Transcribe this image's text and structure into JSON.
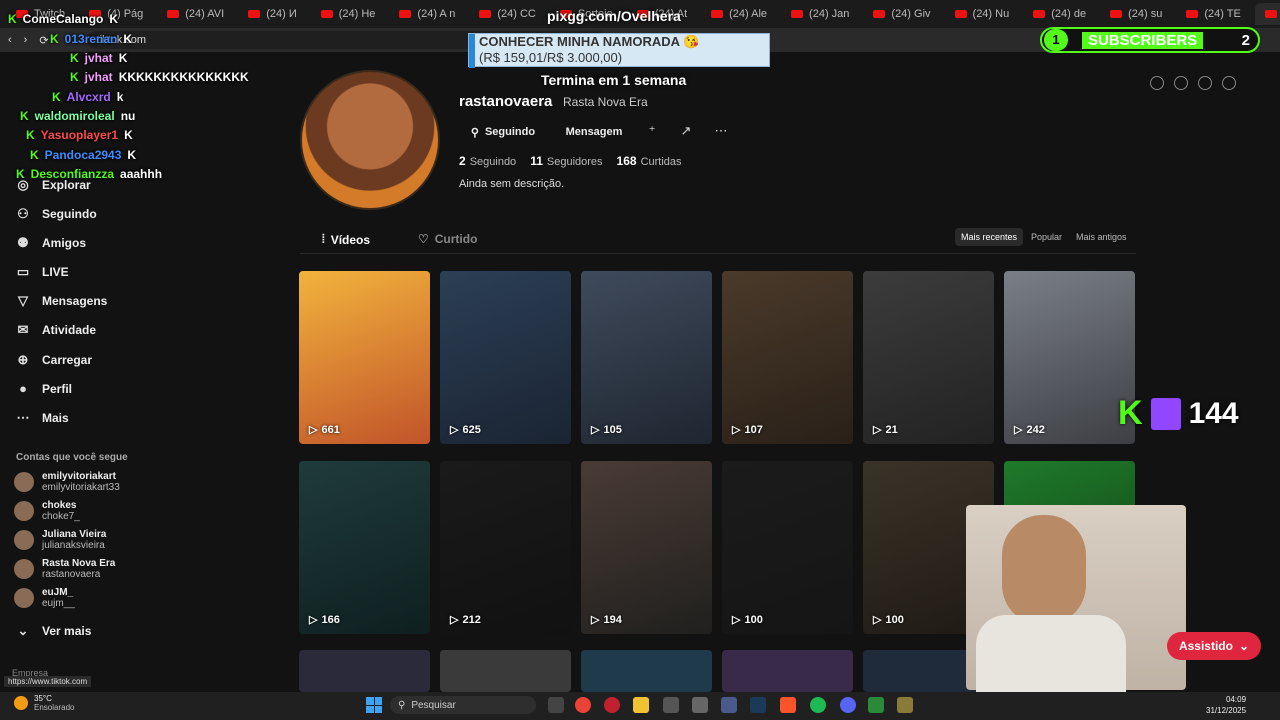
{
  "browser": {
    "tabs": [
      "Twitch",
      "(4) Pág",
      "(24) AVI",
      "(24) И",
      "(24) He",
      "(24) A n",
      "(24) CC",
      "Sorteio",
      "(24) At",
      "(24) Ale",
      "(24) Jan",
      "(24) Giv",
      "(24) Nu",
      "(24) de",
      "(24) su",
      "(24) TE",
      "(4)"
    ],
    "url": "tiktok.com"
  },
  "overlay": {
    "pixgg": "pixgg.com/Ovelhera",
    "banner_line1": "CONHECER MINHA NAMORADA 😘",
    "banner_line2": "(R$ 159,01/R$ 3.000,00)",
    "termina": "Termina em 1 semana",
    "subs_count": "1",
    "subs_label": "SUBSCRIBERS",
    "subs_goal": "2",
    "viewers": "144",
    "assistido": "Assistido"
  },
  "chat": [
    {
      "user": "ComeCalango",
      "color": "#ffffff",
      "msg": "K"
    },
    {
      "user": "013renan",
      "color": "#3f8cff",
      "msg": "K"
    },
    {
      "user": "jvhat",
      "color": "#f5a0ff",
      "msg": "K"
    },
    {
      "user": "jvhat",
      "color": "#f5a0ff",
      "msg": "KKKKKKKKKKKKKKK"
    },
    {
      "user": "Alvcxrd",
      "color": "#a36bff",
      "msg": "k"
    },
    {
      "user": "waldomiroleal",
      "color": "#7dffa0",
      "msg": "nu"
    },
    {
      "user": "Yasuoplayer1",
      "color": "#ff4b4b",
      "msg": "K"
    },
    {
      "user": "Pandoca2943",
      "color": "#3f8cff",
      "msg": "K"
    },
    {
      "user": "Desconfianzza",
      "color": "#53fc18",
      "msg": "aaahhh"
    }
  ],
  "sidebar": {
    "items": [
      {
        "label": "Explorar",
        "icon": "compass-icon"
      },
      {
        "label": "Seguindo",
        "icon": "user-icon"
      },
      {
        "label": "Amigos",
        "icon": "users-icon"
      },
      {
        "label": "LIVE",
        "icon": "live-icon"
      },
      {
        "label": "Mensagens",
        "icon": "message-icon"
      },
      {
        "label": "Atividade",
        "icon": "activity-icon"
      },
      {
        "label": "Carregar",
        "icon": "plus-icon"
      },
      {
        "label": "Perfil",
        "icon": "avatar-icon"
      },
      {
        "label": "Mais",
        "icon": "more-icon"
      }
    ],
    "section_title": "Contas que você segue",
    "following": [
      {
        "name": "emilyvitoriakart",
        "handle": "emilyvitoriakart33"
      },
      {
        "name": "chokes",
        "handle": "choke7_"
      },
      {
        "name": "Juliana Vieira",
        "handle": "julianaksvieira"
      },
      {
        "name": "Rasta Nova Era",
        "handle": "rastanovaera"
      },
      {
        "name": "euJM_",
        "handle": "eujm__"
      }
    ],
    "ver_mais": "Ver mais",
    "empresa": "Empresa",
    "url_hint": "https://www.tiktok.com"
  },
  "profile": {
    "username": "rastanovaera",
    "display_name": "Rasta Nova Era",
    "follow_btn": "Seguindo",
    "message_btn": "Mensagem",
    "following_count": "2",
    "following_label": "Seguindo",
    "followers_count": "11",
    "followers_label": "Seguidores",
    "likes_count": "168",
    "likes_label": "Curtidas",
    "bio": "Ainda sem descrição.",
    "tab_videos": "Vídeos",
    "tab_liked": "Curtido",
    "sort": [
      "Mais recentes",
      "Popular",
      "Mais antigos"
    ]
  },
  "videos": [
    {
      "views": "661",
      "colors": [
        "#f2b33c",
        "#c1542a"
      ]
    },
    {
      "views": "625",
      "colors": [
        "#2c3f55",
        "#1a2433"
      ]
    },
    {
      "views": "105",
      "colors": [
        "#3f4a5c",
        "#1e2630"
      ]
    },
    {
      "views": "107",
      "colors": [
        "#4a3a2a",
        "#2a2018"
      ]
    },
    {
      "views": "21",
      "colors": [
        "#3c3c3c",
        "#222"
      ]
    },
    {
      "views": "242",
      "colors": [
        "#7a7f87",
        "#3d3f44"
      ]
    },
    {
      "views": "166",
      "colors": [
        "#1f3b3a",
        "#0f1f20"
      ]
    },
    {
      "views": "212",
      "colors": [
        "#1a1a1a",
        "#111"
      ]
    },
    {
      "views": "194",
      "colors": [
        "#4a3b35",
        "#20201e"
      ]
    },
    {
      "views": "100",
      "colors": [
        "#1b1b1b",
        "#151515"
      ]
    },
    {
      "views": "100",
      "colors": [
        "#3a3328",
        "#1f1a14"
      ]
    },
    {
      "views": "",
      "colors": [
        "#1f7a2a",
        "#0d3a12"
      ]
    }
  ],
  "taskbar": {
    "temp": "35°C",
    "weather": "Ensolarado",
    "search": "Pesquisar",
    "time": "04:09",
    "date": "31/12/2025"
  }
}
